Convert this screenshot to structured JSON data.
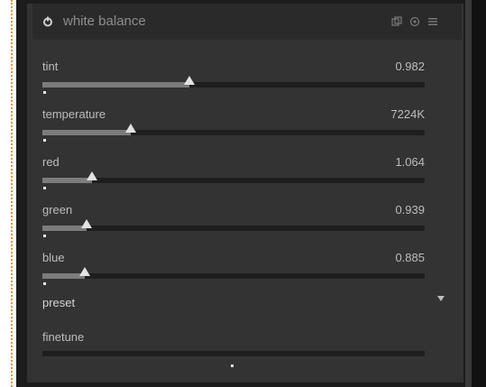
{
  "module": {
    "title": "white balance",
    "header_icons": [
      "power-icon",
      "copy-icon",
      "reset-icon",
      "menu-icon"
    ]
  },
  "sliders": [
    {
      "id": "tint",
      "label": "tint",
      "value": "0.982",
      "position": 0.385
    },
    {
      "id": "temperature",
      "label": "temperature",
      "value": "7224K",
      "position": 0.23
    },
    {
      "id": "red",
      "label": "red",
      "value": "1.064",
      "position": 0.13
    },
    {
      "id": "green",
      "label": "green",
      "value": "0.939",
      "position": 0.115
    },
    {
      "id": "blue",
      "label": "blue",
      "value": "0.885",
      "position": 0.11
    }
  ],
  "preset": {
    "label": "preset"
  },
  "finetune": {
    "label": "finetune"
  },
  "colors": {
    "panel_bg": "#333333",
    "header_bg": "#2a2a2a",
    "track": "#1e1e1e",
    "fill": "#7c7c7c",
    "thumb": "#e2e2e2",
    "text": "#bdbdbd",
    "border_dots": "#d99a3a"
  }
}
